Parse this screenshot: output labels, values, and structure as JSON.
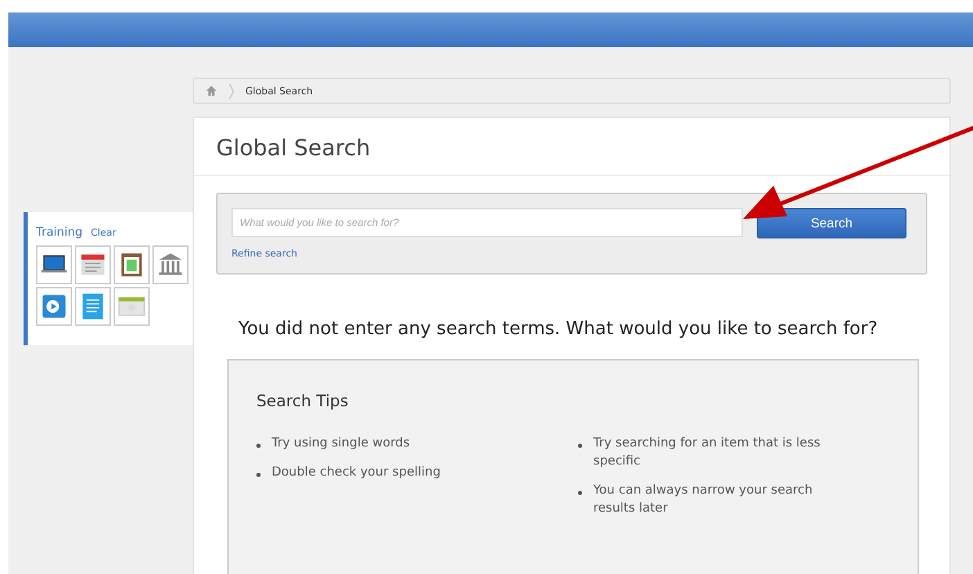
{
  "breadcrumb": {
    "items": [
      "Global Search"
    ]
  },
  "sidebar": {
    "title": "Training",
    "clear_link": "Clear"
  },
  "page_title": "Global Search",
  "search": {
    "placeholder": "What would you like to search for?",
    "button": "Search",
    "refine_link": "Refine search"
  },
  "message": "You did not enter any search terms. What would you like to search for?",
  "tips": {
    "title": "Search Tips",
    "columns": [
      [
        "Try using single words",
        "Double check your spelling"
      ],
      [
        "Try searching for an item that is less specific",
        "You can always narrow your search results later"
      ]
    ]
  }
}
